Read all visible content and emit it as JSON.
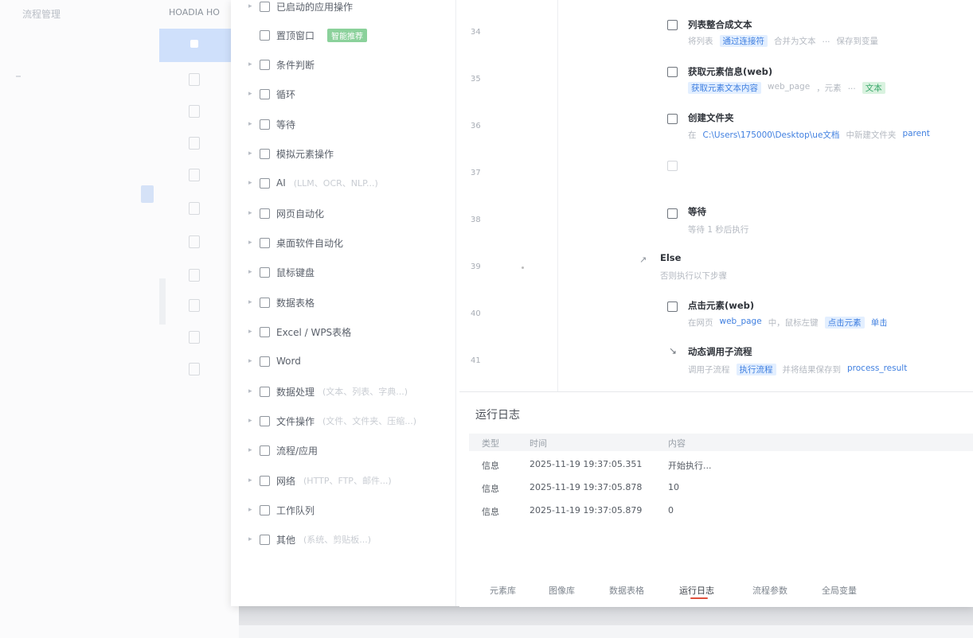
{
  "background_window": {
    "title": "流程管理",
    "column_header": "HOADIA HO"
  },
  "tree": {
    "items": [
      {
        "label": "已启动的应用操作",
        "note": "",
        "icon": "app-icon"
      },
      {
        "label": "置顶窗口",
        "note": "",
        "badge": "智能推荐",
        "icon": "pin-icon"
      },
      {
        "label": "条件判断",
        "note": "",
        "icon": "branch-icon"
      },
      {
        "label": "循环",
        "note": "",
        "icon": "loop-icon"
      },
      {
        "label": "等待",
        "note": "",
        "icon": "hourglass-icon"
      },
      {
        "label": "模拟元素操作",
        "note": "",
        "icon": "element-icon"
      },
      {
        "label": "AI",
        "note": "(LLM、OCR、NLP...)",
        "icon": "ai-icon"
      },
      {
        "label": "网页自动化",
        "note": "",
        "icon": "web-icon"
      },
      {
        "label": "桌面软件自动化",
        "note": "",
        "icon": "desktop-icon"
      },
      {
        "label": "鼠标键盘",
        "note": "",
        "icon": "mouse-icon"
      },
      {
        "label": "数据表格",
        "note": "",
        "icon": "table-icon"
      },
      {
        "label": "Excel / WPS表格",
        "note": "",
        "icon": "excel-icon"
      },
      {
        "label": "Word",
        "note": "",
        "icon": "word-icon"
      },
      {
        "label": "数据处理",
        "note": "(文本、列表、字典...)",
        "icon": "data-icon"
      },
      {
        "label": "文件操作",
        "note": "(文件、文件夹、压缩...)",
        "icon": "file-icon"
      },
      {
        "label": "流程/应用",
        "note": "",
        "icon": "flow-icon"
      },
      {
        "label": "网络",
        "note": "(HTTP、FTP、邮件...)",
        "icon": "network-icon"
      },
      {
        "label": "工作队列",
        "note": "",
        "icon": "queue-icon"
      },
      {
        "label": "其他",
        "note": "(系统、剪贴板...)",
        "icon": "misc-icon"
      }
    ]
  },
  "line_numbers": [
    "34",
    "35",
    "36",
    "37",
    "38",
    "39",
    "40",
    "41"
  ],
  "steps": [
    {
      "title": "列表整合成文本",
      "desc": [
        "将列表",
        "通过连接符",
        "合并为文本",
        "...",
        "保存到变量"
      ]
    },
    {
      "title": "获取元素信息(web)",
      "desc": [
        "获取元素文本内容",
        "web_page",
        "，元素",
        "...",
        "文本"
      ]
    },
    {
      "title": "创建文件夹",
      "desc": [
        "在",
        "C:\\Users\\175000\\Desktop\\ue文档",
        "中新建文件夹",
        "parent"
      ]
    },
    {
      "title": "",
      "desc": []
    },
    {
      "title": "等待",
      "desc": [
        "等待 1 秒后执行"
      ]
    },
    {
      "title": "Else",
      "desc": [
        "否则执行以下步骤"
      ]
    },
    {
      "title": "点击元素(web)",
      "desc": [
        "在网页",
        "web_page",
        "中，鼠标左键",
        "点击元素",
        "单击"
      ]
    },
    {
      "title": "动态调用子流程",
      "desc": [
        "调用子流程",
        "执行流程",
        "并将结果保存到",
        "process_result"
      ]
    }
  ],
  "log": {
    "title": "运行日志",
    "headers": [
      "类型",
      "时间",
      "内容"
    ],
    "rows": [
      {
        "type": "信息",
        "time": "2025-11-19 19:37:05.351",
        "content": "开始执行..."
      },
      {
        "type": "信息",
        "time": "2025-11-19 19:37:05.878",
        "content": "10"
      },
      {
        "type": "信息",
        "time": "2025-11-19 19:37:05.879",
        "content": "0"
      }
    ],
    "tabs": [
      "元素库",
      "图像库",
      "数据表格",
      "运行日志",
      "流程参数",
      "全局变量"
    ],
    "active_tab": 3
  },
  "colors": {
    "accent": "#3f7fe0",
    "tab_underline": "#e0503c",
    "selected_row": "#cfe0fb",
    "badge_green": "#8bd19b"
  }
}
